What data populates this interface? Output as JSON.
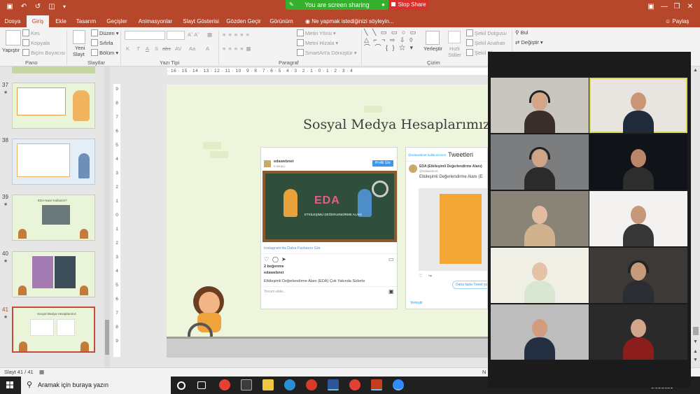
{
  "quick_access": {
    "save_icon": "save-icon",
    "undo_icon": "undo-icon",
    "redo_icon": "redo-icon",
    "present_icon": "present-icon"
  },
  "screen_share": {
    "status": "You are screen sharing",
    "stop_label": "Stop Share"
  },
  "tabs": [
    "Dosya",
    "Giriş",
    "Ekle",
    "Tasarım",
    "Geçişler",
    "Animasyonlar",
    "Slayt Gösterisi",
    "Gözden Geçir",
    "Görünüm"
  ],
  "active_tab": "Giriş",
  "tell_me": "Ne yapmak istediğinizi söyleyin...",
  "share_label": "Paylaş",
  "ribbon": {
    "pano": {
      "paste": "Yapıştır",
      "cut": "Kes",
      "copy": "Kopyala",
      "format_painter": "Biçim Boyacısı",
      "group": "Pano"
    },
    "slaytlar": {
      "new_slide": "Yeni",
      "new_slide2": "Slayt",
      "layout": "Düzen",
      "reset": "Sıfırla",
      "section": "Bölüm",
      "group": "Slaytlar"
    },
    "yazi_tipi": {
      "group": "Yazı Tipi",
      "buttons": [
        "K",
        "T",
        "A",
        "S",
        "abc",
        "AV",
        "Aa",
        "A"
      ]
    },
    "paragraf": {
      "text_direction": "Metin Yönü",
      "align_text": "Metni Hizala",
      "smartart": "SmartArt'a Dönüştür",
      "group": "Paragraf"
    },
    "cizim": {
      "arrange": "Yerleştir",
      "quick_styles": "Hızlı",
      "quick_styles2": "Stiller",
      "shape_fill": "Şekil Dolgusu",
      "shape_outline": "Şekil Anahatı",
      "shape_effects": "Şekil Efe",
      "group": "Çizim"
    },
    "duzenleme": {
      "find": "Bul",
      "replace": "Değiştir"
    }
  },
  "slides_panel": {
    "items": [
      {
        "num": "37",
        "title": "",
        "selected": false
      },
      {
        "num": "38",
        "title": "",
        "selected": false
      },
      {
        "num": "39",
        "title": "EDA Nasıl Kullanılır?",
        "selected": false
      },
      {
        "num": "40",
        "title": "",
        "selected": false
      },
      {
        "num": "41",
        "title": "Sosyal Medya Hesaplarımız",
        "selected": true
      }
    ]
  },
  "ruler": {
    "horizontal": "· 16 · 15 · 14 · 13 · 12 · 11 · 10 · 9 · 8 · 7 · 6 · 5 · 4 · 3 · 2 · 1 · 0 · 1 · 2 · 3 · 4",
    "vertical": [
      "9",
      "8",
      "7",
      "6",
      "5",
      "4",
      "3",
      "2",
      "1",
      "0",
      "1",
      "2",
      "3",
      "4",
      "5",
      "6",
      "7",
      "8",
      "9"
    ]
  },
  "slide": {
    "title": "Sosyal Medya Hesaplarımız",
    "instagram": {
      "account": "edawebnet",
      "subtitle": "5 takipçi",
      "profile_button": "Profili Gör",
      "board_text": "EDA",
      "board_caption": "ETKİLEŞİMLİ DEĞERLENDİRME ALANI",
      "more_link": "Instagram'da Daha Fazlasını Gör",
      "likes": "2 beğenme",
      "user": "edawebnet",
      "caption": "Etkileşimli Değerlendirme Alanı (EDA) Çok Yakında Sizlerle",
      "comment_placeholder": "Yorum ekle..."
    },
    "twitter": {
      "header_handle": "@edawebnet kullanıcısının",
      "header_title": "Tweetleri",
      "name": "EDA (Etkileşimli Değerlendirme Alanı)",
      "handle": "@edawebnet",
      "text": "Etkileşimli Değerlendirme Alanı (E",
      "more_button": "Daha fazla Tweet yü",
      "embed": "Yerleştir"
    }
  },
  "status": {
    "slide_info": "Slayt 41 / 41",
    "notes": "N"
  },
  "taskbar": {
    "search_placeholder": "Aramak için buraya yazın",
    "date": "5.01.2021"
  },
  "zoom": {
    "participants": [
      {
        "bg": "#c9c5bf",
        "skin": "#d4a587",
        "shirt": "#3a2f2a",
        "headset": true,
        "active": false
      },
      {
        "bg": "#e8e4df",
        "skin": "#c99574",
        "shirt": "#1f2a3a",
        "headset": false,
        "active": true
      },
      {
        "bg": "#7c7d7e",
        "skin": "#d0a587",
        "shirt": "#2b2b2b",
        "headset": true,
        "active": false
      },
      {
        "bg": "#101418",
        "skin": "#b98669",
        "shirt": "#2d2d2d",
        "headset": false,
        "active": false
      },
      {
        "bg": "#8a8378",
        "skin": "#e2bca1",
        "shirt": "#d1b28e",
        "headset": false,
        "active": false
      },
      {
        "bg": "#f3f2f0",
        "skin": "#c7977a",
        "shirt": "#363636",
        "headset": false,
        "active": false
      },
      {
        "bg": "#f0efe6",
        "skin": "#e5c2a5",
        "shirt": "#d8e6d2",
        "headset": false,
        "active": false
      },
      {
        "bg": "#3c3937",
        "skin": "#c79a7c",
        "shirt": "#2b2d33",
        "headset": true,
        "active": false
      },
      {
        "bg": "#bdbdbd",
        "skin": "#d19c7f",
        "shirt": "#243042",
        "headset": false,
        "active": false
      },
      {
        "bg": "#2a2a2a",
        "skin": "#d2a68a",
        "shirt": "#8c1d1d",
        "headset": false,
        "active": false
      }
    ]
  }
}
